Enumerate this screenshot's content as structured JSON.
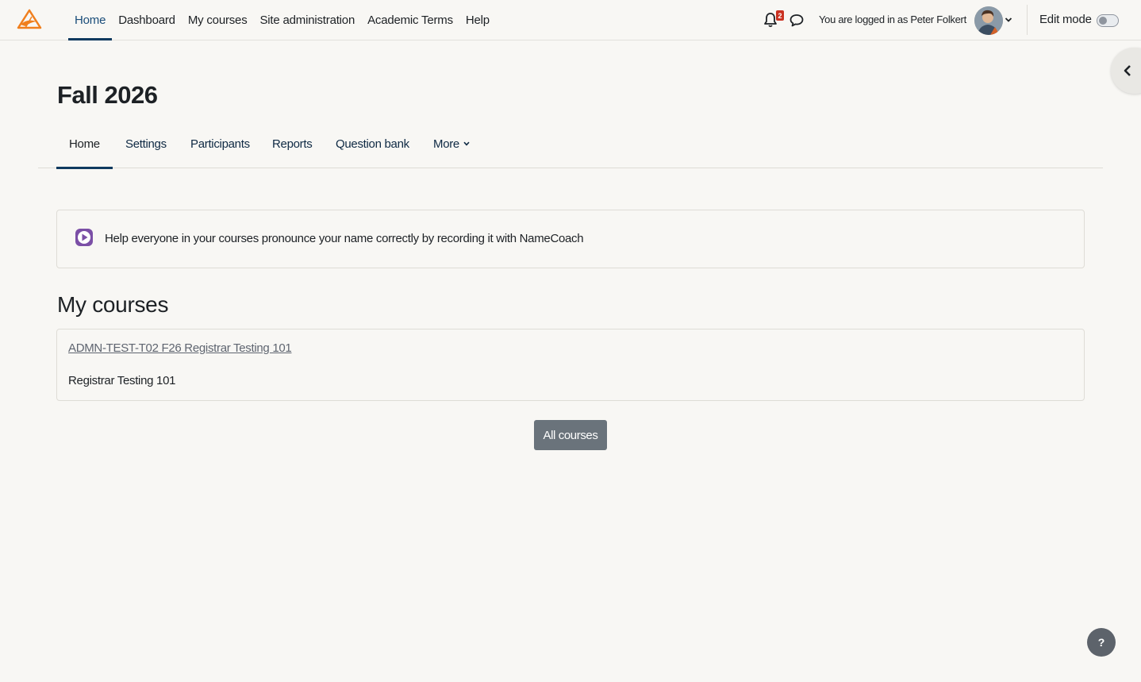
{
  "navbar": {
    "items": [
      {
        "label": "Home",
        "active": true
      },
      {
        "label": "Dashboard"
      },
      {
        "label": "My courses"
      },
      {
        "label": "Site administration"
      },
      {
        "label": "Academic Terms"
      },
      {
        "label": "Help"
      }
    ],
    "notification_count": "2",
    "login_text": "You are logged in as Peter Folkert",
    "edit_mode_label": "Edit mode",
    "edit_mode_on": false
  },
  "page": {
    "title": "Fall 2026",
    "tabs": [
      {
        "label": "Home",
        "active": true
      },
      {
        "label": "Settings"
      },
      {
        "label": "Participants"
      },
      {
        "label": "Reports"
      },
      {
        "label": "Question bank"
      },
      {
        "label": "More"
      }
    ]
  },
  "namecoach": {
    "text": "Help everyone in your courses pronounce your name correctly by recording it with NameCoach"
  },
  "my_courses": {
    "heading": "My courses",
    "courses": [
      {
        "link": "ADMN-TEST-T02 F26 Registrar Testing 101",
        "summary": "Registrar Testing 101"
      }
    ],
    "all_courses_label": "All courses"
  },
  "help_button": "?",
  "colors": {
    "accent": "#0f3a5f",
    "background": "#f8f7f4",
    "button": "#6a737b",
    "badge": "#ca3120",
    "namecoach_purple": "#7b4fa6"
  }
}
